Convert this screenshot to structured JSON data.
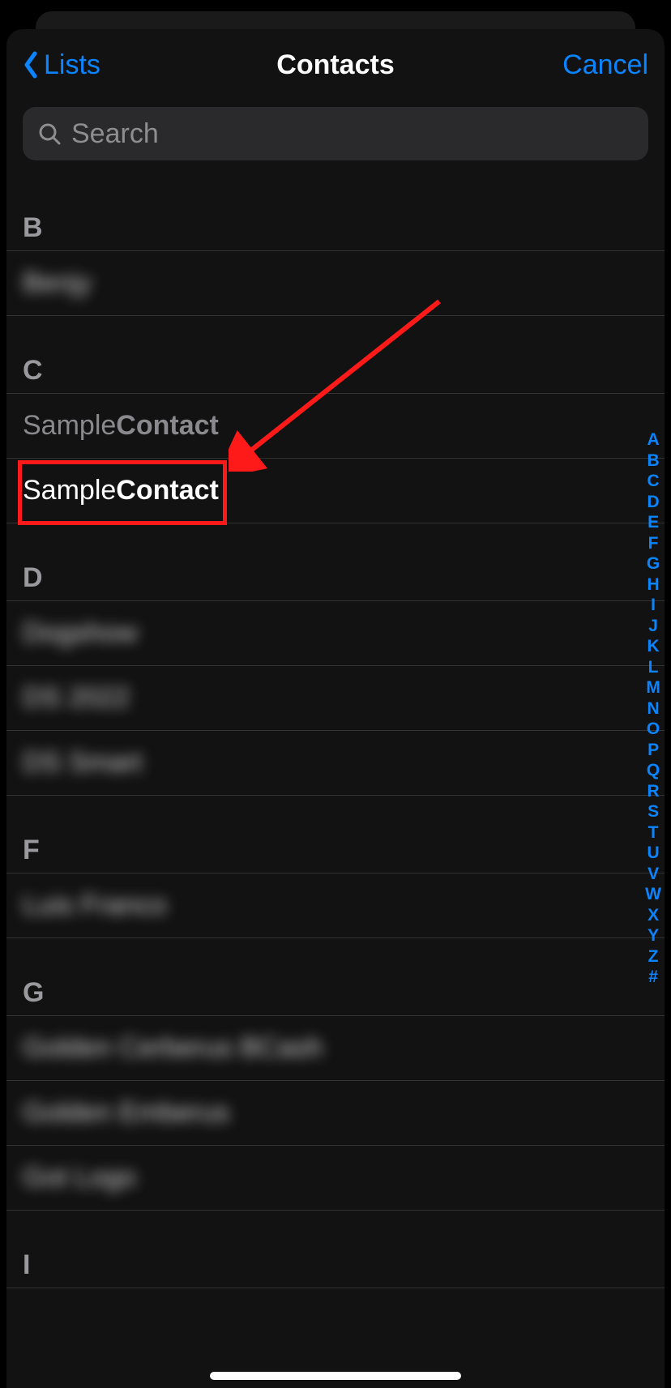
{
  "nav": {
    "back_label": "Lists",
    "title": "Contacts",
    "cancel_label": "Cancel"
  },
  "search": {
    "placeholder": "Search"
  },
  "sections": [
    {
      "letter": "B",
      "items": [
        {
          "first": "Benjy",
          "last": "",
          "blurred": true
        }
      ]
    },
    {
      "letter": "C",
      "items": [
        {
          "first": "Sample ",
          "last": "Contact",
          "dimmed": true
        },
        {
          "first": "Sample ",
          "last": "Contact",
          "highlighted": true
        }
      ]
    },
    {
      "letter": "D",
      "items": [
        {
          "first": "Dogshow",
          "last": "",
          "blurred": true
        },
        {
          "first": "DS 2022",
          "last": "",
          "blurred": true
        },
        {
          "first": "DS Smart",
          "last": "",
          "blurred": true
        }
      ]
    },
    {
      "letter": "F",
      "items": [
        {
          "first": "Luis Franco",
          "last": "",
          "blurred": true
        }
      ]
    },
    {
      "letter": "G",
      "items": [
        {
          "first": "Golden Cerberus BCash",
          "last": "",
          "blurred": true
        },
        {
          "first": "Golden Emberus",
          "last": "",
          "blurred": true
        },
        {
          "first": "Got Logo",
          "last": "",
          "blurred": true
        }
      ]
    },
    {
      "letter": "I",
      "items": []
    }
  ],
  "index": [
    "A",
    "B",
    "C",
    "D",
    "E",
    "F",
    "G",
    "H",
    "I",
    "J",
    "K",
    "L",
    "M",
    "N",
    "O",
    "P",
    "Q",
    "R",
    "S",
    "T",
    "U",
    "V",
    "W",
    "X",
    "Y",
    "Z",
    "#"
  ],
  "annotations": {
    "highlight_color": "#ff1a1a",
    "arrow_color": "#ff1a1a"
  }
}
